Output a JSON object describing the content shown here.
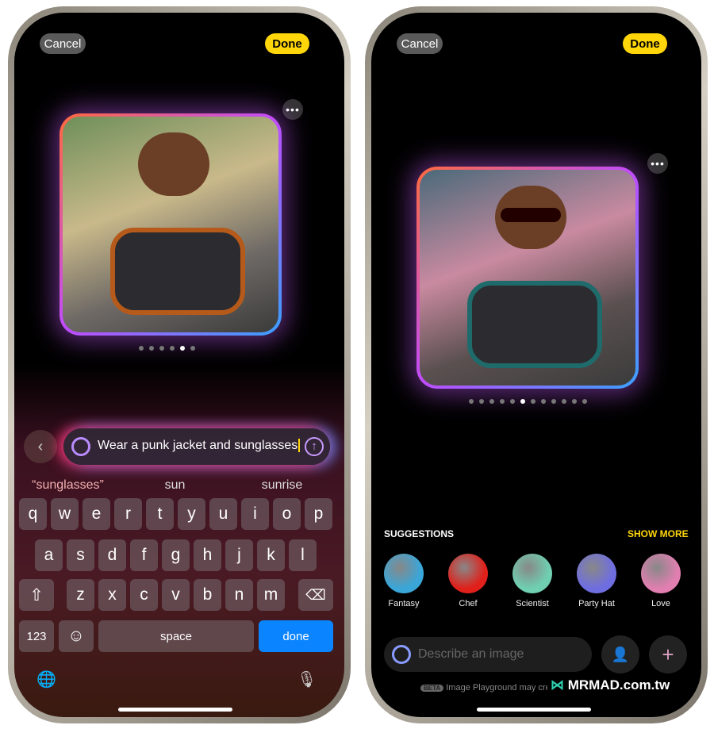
{
  "left": {
    "cancel": "Cancel",
    "done": "Done",
    "more": "•••",
    "page_dots": {
      "count": 6,
      "active": 5
    },
    "prompt": {
      "value": "Wear a punk jacket and sunglasses"
    },
    "autocorrect": [
      "“sunglasses”",
      "sun",
      "sunrise"
    ],
    "keyboard": {
      "rows": [
        [
          "q",
          "w",
          "e",
          "r",
          "t",
          "y",
          "u",
          "i",
          "o",
          "p"
        ],
        [
          "a",
          "s",
          "d",
          "f",
          "g",
          "h",
          "j",
          "k",
          "l"
        ],
        [
          "z",
          "x",
          "c",
          "v",
          "b",
          "n",
          "m"
        ]
      ],
      "shift": "⇧",
      "delete": "⌫",
      "numbers": "123",
      "emoji": "☺",
      "space": "space",
      "done": "done",
      "globe": "🌐",
      "mic": "🎙"
    }
  },
  "right": {
    "cancel": "Cancel",
    "done": "Done",
    "more": "•••",
    "page_dots": {
      "count": 12,
      "active": 6
    },
    "suggestions_title": "SUGGESTIONS",
    "show_more": "SHOW MORE",
    "suggestions": [
      {
        "label": "Fantasy",
        "color": "#3aa6d8"
      },
      {
        "label": "Chef",
        "color": "#e0201a"
      },
      {
        "label": "Scientist",
        "color": "#6fcfb0"
      },
      {
        "label": "Party Hat",
        "color": "#6f6ee0"
      },
      {
        "label": "Love",
        "color": "#e07fb0"
      }
    ],
    "prompt_placeholder": "Describe an image",
    "beta": "BETA",
    "disclaimer": "Image Playground may create unexpected results.",
    "watermark": "MRMAD.com.tw"
  },
  "colors": {
    "accent": "#ffd60a",
    "keyboard_done": "#0a84ff"
  }
}
